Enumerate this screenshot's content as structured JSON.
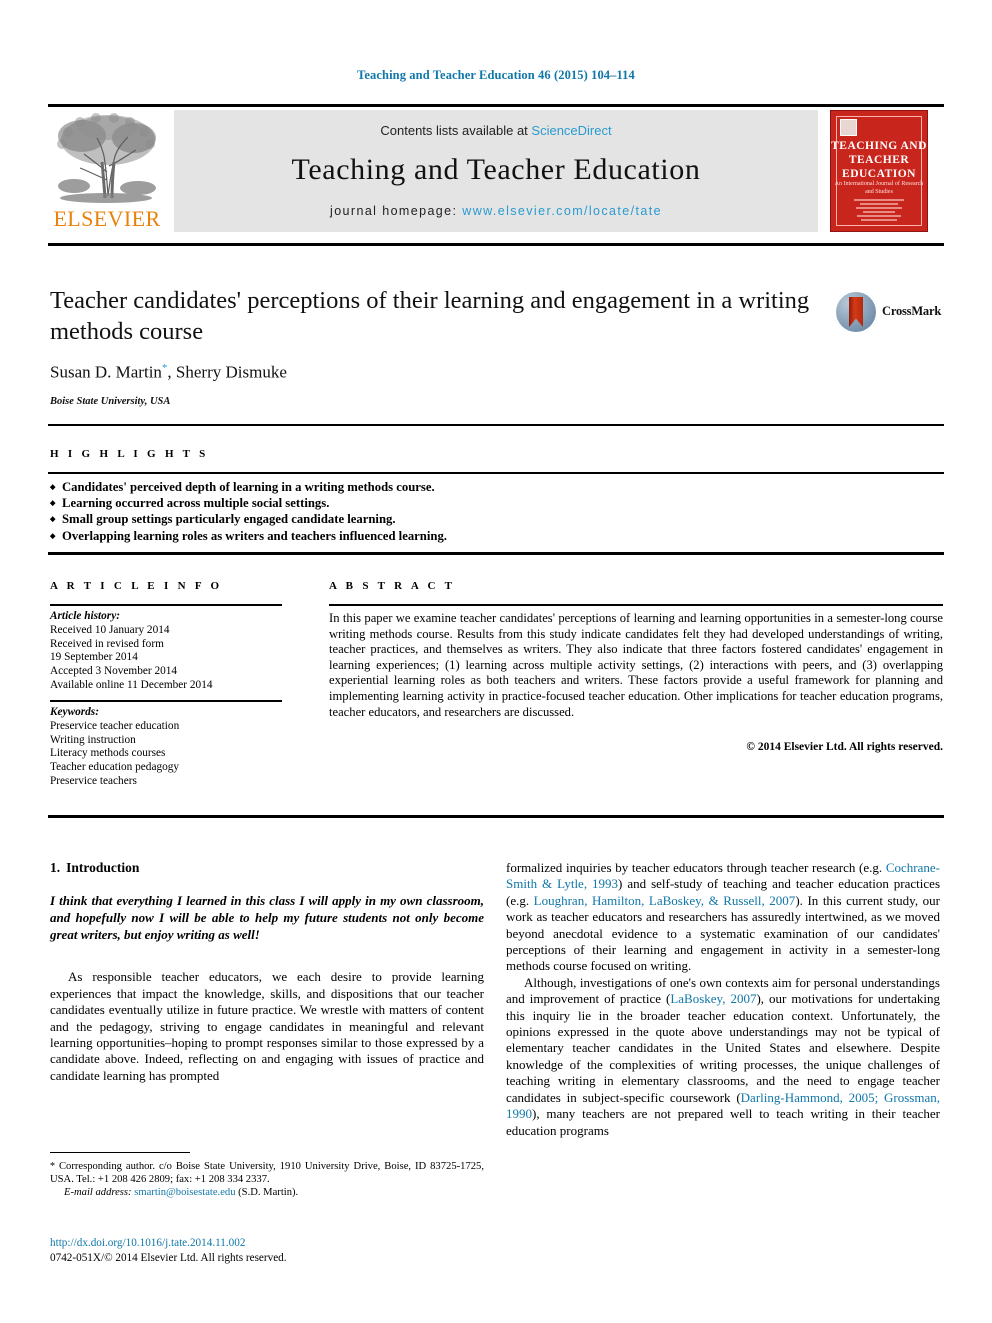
{
  "running_head": "Teaching and Teacher Education 46 (2015) 104–114",
  "masthead": {
    "publisher_name": "ELSEVIER",
    "contents_prefix": "Contents lists available at ",
    "contents_link": "ScienceDirect",
    "journal_title": "Teaching and Teacher Education",
    "homepage_prefix": "journal homepage: ",
    "homepage_url": "www.elsevier.com/locate/tate",
    "cover": {
      "title_lines": "TEACHING AND TEACHER EDUCATION",
      "subtitle": "An International Journal of Research and Studies"
    }
  },
  "article": {
    "title": "Teacher candidates' perceptions of their learning and engagement in a writing methods course",
    "crossmark_label": "CrossMark",
    "authors": "Susan D. Martin",
    "author_marker": "*",
    "authors_rest": ", Sherry Dismuke",
    "affiliation": "Boise State University, USA"
  },
  "highlights": {
    "heading": "H I G H L I G H T S",
    "items": [
      "Candidates' perceived depth of learning in a writing methods course.",
      "Learning occurred across multiple social settings.",
      "Small group settings particularly engaged candidate learning.",
      "Overlapping learning roles as writers and teachers influenced learning."
    ]
  },
  "article_info": {
    "heading": "A R T I C L E   I N F O",
    "history_label": "Article history:",
    "history_lines": [
      "Received 10 January 2014",
      "Received in revised form",
      "19 September 2014",
      "Accepted 3 November 2014",
      "Available online 11 December 2014"
    ],
    "keywords_label": "Keywords:",
    "keywords": [
      "Preservice teacher education",
      "Writing instruction",
      "Literacy methods courses",
      "Teacher education pedagogy",
      "Preservice teachers"
    ]
  },
  "abstract": {
    "heading": "A B S T R A C T",
    "text": "In this paper we examine teacher candidates' perceptions of learning and learning opportunities in a semester-long course writing methods course. Results from this study indicate candidates felt they had developed understandings of writing, teacher practices, and themselves as writers. They also indicate that three factors fostered candidates' engagement in learning experiences; (1) learning across multiple activity settings, (2) interactions with peers, and (3) overlapping experiential learning roles as both teachers and writers. These factors provide a useful framework for planning and implementing learning activity in practice-focused teacher education. Other implications for teacher education programs, teacher educators, and researchers are discussed.",
    "copyright": "© 2014 Elsevier Ltd. All rights reserved."
  },
  "body": {
    "section_number": "1.",
    "section_title": "Introduction",
    "pullquote": "I think that everything I learned in this class I will apply in my own classroom, and hopefully now I will be able to help my future students not only become great writers, but enjoy writing as well!",
    "left_para_1_a": "As responsible teacher educators, we each desire to provide learning experiences that impact the knowledge, skills, and dispositions that our teacher candidates eventually utilize in future practice. We wrestle with matters of content and the pedagogy, striving to engage candidates in meaningful and relevant learning opportunities–hoping to prompt responses similar to those expressed by a candidate above. Indeed, reflecting on and engaging with issues of practice and candidate learning has prompted",
    "right_para_1_a": "formalized inquiries by teacher educators through teacher research (e.g. ",
    "right_para_1_ref1": "Cochrane-Smith & Lytle, 1993",
    "right_para_1_b": ") and self-study of teaching and teacher education practices (e.g. ",
    "right_para_1_ref2": "Loughran, Hamilton, LaBoskey, & Russell, 2007",
    "right_para_1_c": "). In this current study, our work as teacher educators and researchers has assuredly intertwined, as we moved beyond anecdotal evidence to a systematic examination of our candidates' perceptions of their learning and engagement in activity in a semester-long methods course focused on writing.",
    "right_para_2_a": "Although, investigations of one's own contexts aim for personal understandings and improvement of practice (",
    "right_para_2_ref1": "LaBoskey, 2007",
    "right_para_2_b": "), our motivations for undertaking this inquiry lie in the broader teacher education context. Unfortunately, the opinions expressed in the quote above understandings may not be typical of elementary teacher candidates in the United States and elsewhere. Despite knowledge of the complexities of writing processes, the unique challenges of teaching writing in elementary classrooms, and the need to engage teacher candidates in subject-specific coursework (",
    "right_para_2_ref2": "Darling-Hammond, 2005; Grossman, 1990",
    "right_para_2_c": "), many teachers are not prepared well to teach writing in their teacher education programs"
  },
  "footnote": {
    "star": "*",
    "corresponding": " Corresponding author. c/o Boise State University, 1910 University Drive, Boise, ID 83725-1725, USA. Tel.: +1 208 426 2809; fax: +1 208 334 2337.",
    "email_label": "E-mail address:",
    "email": "smartin@boisestate.edu",
    "email_suffix": " (S.D. Martin)."
  },
  "doi": {
    "url": "http://dx.doi.org/10.1016/j.tate.2014.11.002",
    "issn_line": "0742-051X/© 2014 Elsevier Ltd. All rights reserved."
  },
  "colors": {
    "link": "#1077a8",
    "banner_bg": "#e4e4e4",
    "elsevier_orange": "#E8820C",
    "cover_red": "#c8251d"
  }
}
